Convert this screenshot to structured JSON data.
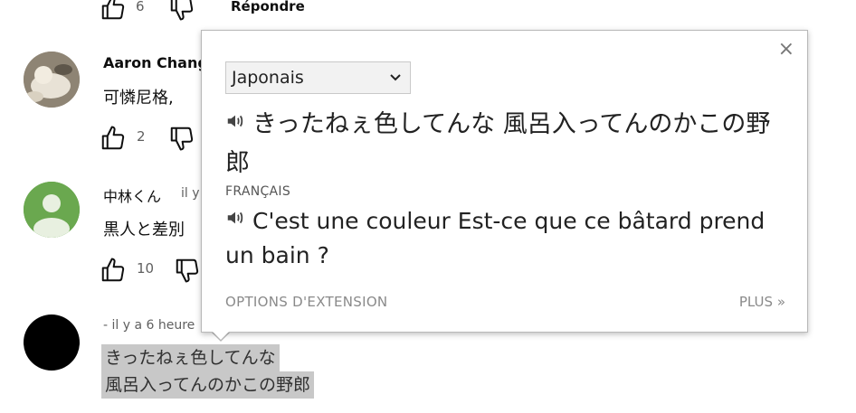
{
  "top_row": {
    "like_count": "6",
    "reply_label": "Répondre"
  },
  "comments": [
    {
      "author": "Aaron Chang",
      "text": "可憐尼格,",
      "like_count": "2"
    },
    {
      "author": "中林くん",
      "timestamp": "il y",
      "text": "黒人と差別",
      "like_count": "10"
    },
    {
      "timestamp": "- il y a 6 heure",
      "text_line1": "きったねぇ色してんな",
      "text_line2": "風呂入ってんのかこの野郎"
    }
  ],
  "popup": {
    "close_label": "×",
    "source_language": "Japonais",
    "source_text": "きったねぇ色してんな 風呂入ってんのかこの野郎",
    "target_language_label": "FRANÇAIS",
    "translated_text": "C'est une couleur Est-ce que ce bâtard prend un bain ?",
    "options_label": "OPTIONS D'EXTENSION",
    "more_label": "PLUS »"
  },
  "icons": {
    "like": "thumbs-up-icon",
    "dislike": "thumbs-down-icon",
    "speaker": "speaker-icon",
    "chevron": "chevron-down-icon"
  }
}
